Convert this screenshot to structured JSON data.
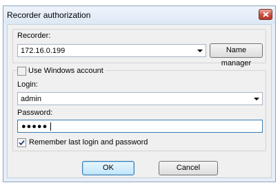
{
  "window": {
    "title": "Recorder authorization"
  },
  "recorder": {
    "label": "Recorder:",
    "value": "172.16.0.199",
    "name_manager_label": "Name manager"
  },
  "auth": {
    "use_windows_account_label": "Use Windows account",
    "use_windows_account_checked": false,
    "login_label": "Login:",
    "login_value": "admin",
    "password_label": "Password:",
    "password_mask": "●●●●●",
    "remember_label": "Remember last login and password",
    "remember_checked": true
  },
  "buttons": {
    "ok_label": "OK",
    "cancel_label": "Cancel"
  },
  "icons": {
    "close": "close-icon",
    "dropdown": "chevron-down-icon",
    "check": "checkmark-icon"
  },
  "colors": {
    "titlebar": "#e7eef8",
    "close_button": "#c7503f",
    "focus_border": "#3d7bad"
  }
}
